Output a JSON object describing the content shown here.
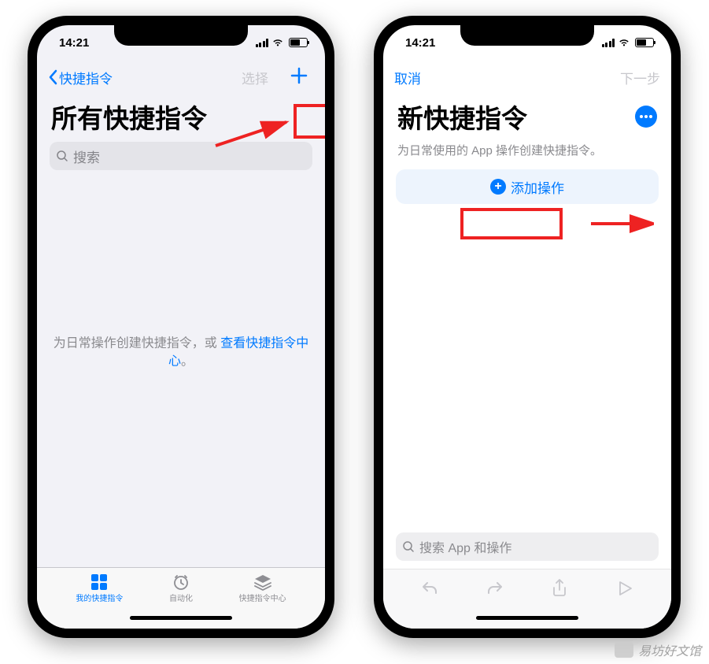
{
  "status": {
    "time": "14:21"
  },
  "left": {
    "nav_back": "快捷指令",
    "nav_select": "选择",
    "title": "所有快捷指令",
    "search_placeholder": "搜索",
    "empty_prefix": "为日常操作创建快捷指令，或 ",
    "empty_link": "查看快捷指令中心",
    "empty_suffix": "。",
    "tabs": [
      {
        "label": "我的快捷指令",
        "active": true
      },
      {
        "label": "自动化",
        "active": false
      },
      {
        "label": "快捷指令中心",
        "active": false
      }
    ]
  },
  "right": {
    "nav_cancel": "取消",
    "nav_next": "下一步",
    "title": "新快捷指令",
    "subtitle": "为日常使用的 App 操作创建快捷指令。",
    "add_action": "添加操作",
    "search_placeholder": "搜索 App 和操作"
  },
  "watermark": "易坊好文馆"
}
